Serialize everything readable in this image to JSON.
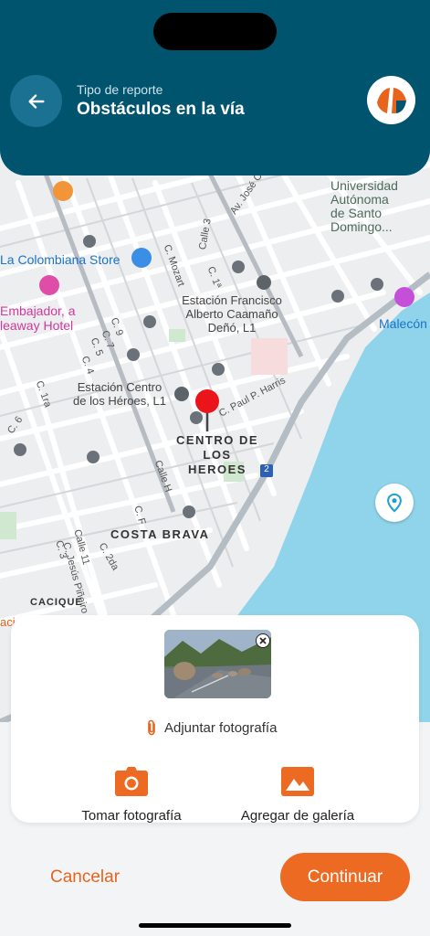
{
  "header": {
    "subtitle": "Tipo de reporte",
    "title": "Obstáculos en la vía",
    "back_icon": "arrow-left-icon",
    "logo_icon": "app-logo-icon"
  },
  "map": {
    "labels": {
      "universidad": "Universidad\nAutónoma\nde Santo\nDomingo...",
      "colombiana": "La Colombiana Store",
      "embajador": "Embajador, a\nleaway Hotel",
      "estacion_francisco": "Estación Francisco\nAlberto Caamaño\nDeñó, L1",
      "estacion_centro": "Estación Centro\nde los Héroes, L1",
      "centro_heroes": "CENTRO DE\nLOS HEROES",
      "costa_brava": "COSTA BRAVA",
      "cacique": "CACIQUE",
      "malecon": "Malecón",
      "paul_harris": "C. Paul P. Harris",
      "av_jose": "Av. José C",
      "calle3": "Calle 3",
      "c_mozart": "C. Mozart",
      "c1": "C. 1ª",
      "c9": "C. 9",
      "c7": "C. 7",
      "c5": "C. 5",
      "c4": "C. 4",
      "c1ra": "C. 1ra",
      "c6": "C. 6",
      "calleh": "Calle H",
      "cf": "C. F",
      "calle11": "Calle 11",
      "cjesus": "C. Jesús Piñeiro",
      "c3": "C. 3",
      "c2da": "C. 2da",
      "route_badge": "2",
      "aci": "aci"
    },
    "marker_icon": "map-pin-icon",
    "location_button_icon": "location-pin-icon",
    "accent_water": "#8fd4ea"
  },
  "attachment": {
    "label": "Adjuntar fotografía",
    "remove_icon": "close-icon",
    "photo_icon": "photo-thumbnail",
    "attach_icon": "paperclip-icon"
  },
  "actions": {
    "camera_label": "Tomar fotografía",
    "gallery_label": "Agregar de galería",
    "camera_icon": "camera-icon",
    "gallery_icon": "gallery-icon"
  },
  "footer": {
    "cancel": "Cancelar",
    "continue": "Continuar"
  },
  "colors": {
    "header": "#00546e",
    "accent": "#ec6a22"
  }
}
